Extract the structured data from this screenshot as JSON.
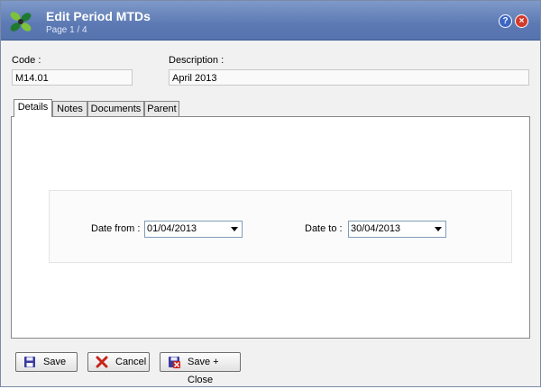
{
  "window": {
    "title": "Edit Period MTDs",
    "subtitle": "Page 1 / 4",
    "help_label": "?",
    "close_label": "×"
  },
  "code": {
    "label": "Code :",
    "value": "M14.01"
  },
  "description": {
    "label": "Description :",
    "value": "April 2013"
  },
  "tabs": [
    {
      "label": "Details",
      "active": true
    },
    {
      "label": "Notes",
      "active": false
    },
    {
      "label": "Documents",
      "active": false
    },
    {
      "label": "Parent",
      "active": false
    }
  ],
  "details": {
    "date_from_label": "Date from :",
    "date_from_value": "01/04/2013",
    "date_to_label": "Date to :",
    "date_to_value": "30/04/2013"
  },
  "buttons": {
    "save": "Save",
    "cancel": "Cancel",
    "save_close": "Save + Close"
  },
  "colors": {
    "title_bar": "#5c79b3",
    "help": "#3e67c4",
    "close": "#d23a2c"
  }
}
